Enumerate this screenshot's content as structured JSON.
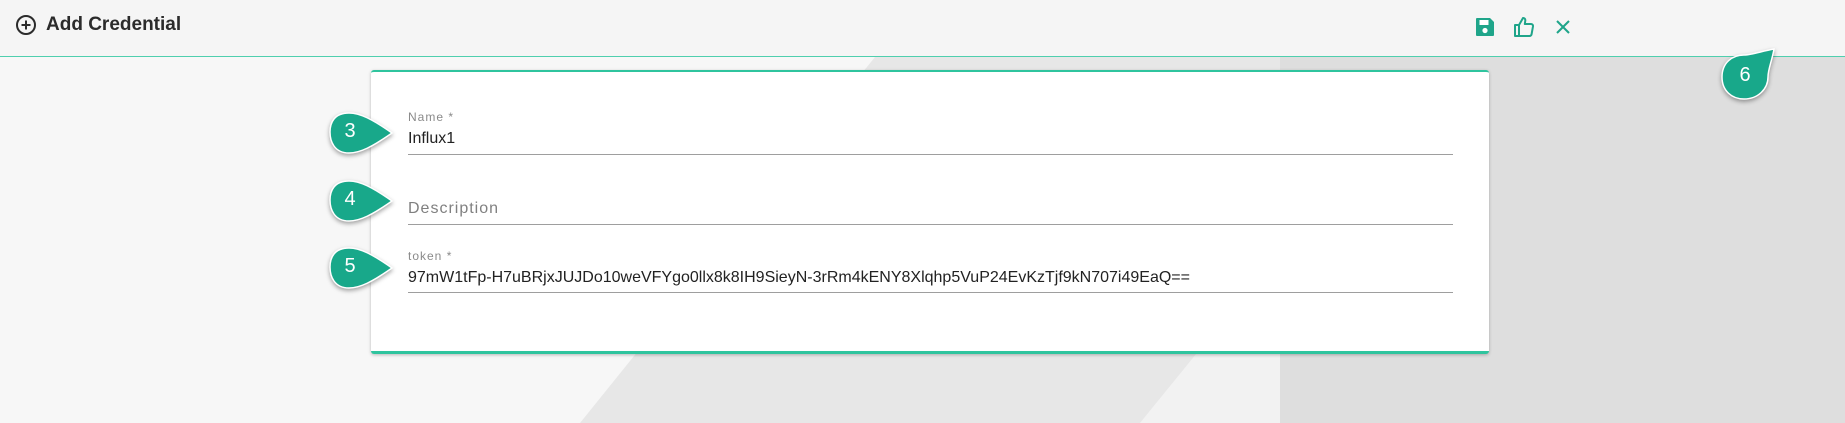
{
  "header": {
    "title": "Add Credential",
    "icons": [
      "plus-circle-icon",
      "save-icon",
      "thumbs-up-icon",
      "close-icon"
    ]
  },
  "form": {
    "name_label": "Name *",
    "name_value": "Influx1",
    "description_placeholder": "Description",
    "token_label": "token *",
    "token_value": "97mW1tFp-H7uBRjxJUJDo10weVFYgo0llx8k8IH9SieyN-3rRm4kENY8Xlqhp5VuP24EvKzTjf9kN707i49EaQ=="
  },
  "callouts": [
    "3",
    "4",
    "5",
    "6"
  ],
  "colors": {
    "accent": "#2fc49e",
    "callout": "#18a88a",
    "header_icon": "#1fa58a",
    "background": "#f7f7f7",
    "background_shape": "#e4e4e4"
  }
}
